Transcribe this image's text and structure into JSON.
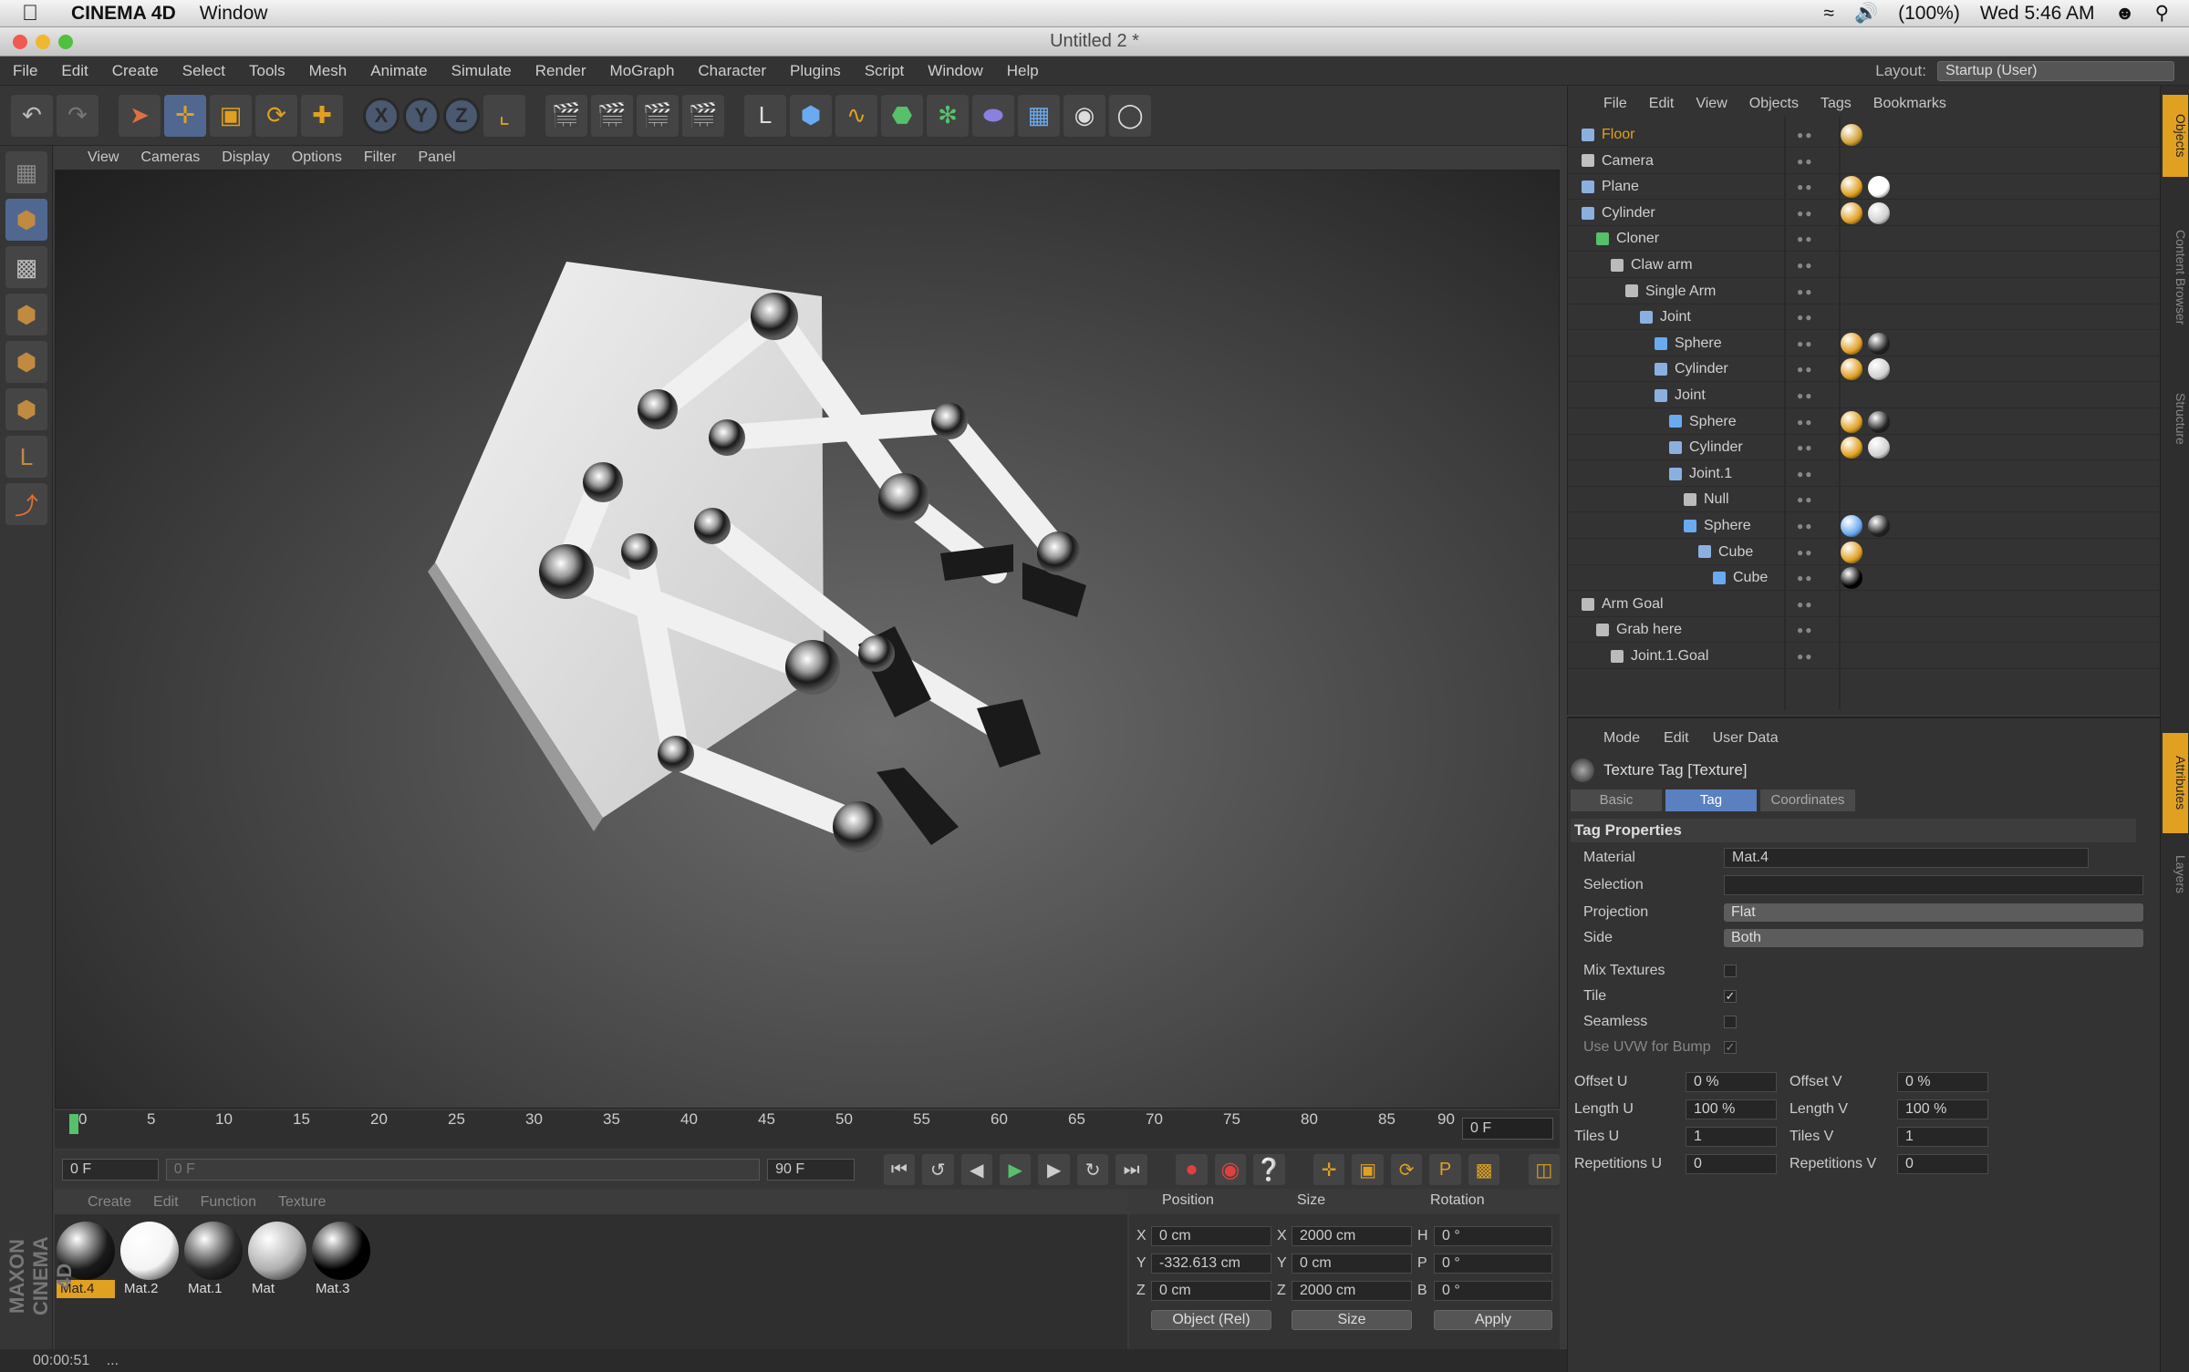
{
  "macbar": {
    "app": "CINEMA 4D",
    "menu": "Window",
    "battery": "(100%)",
    "clock": "Wed 5:46 AM"
  },
  "window": {
    "title": "Untitled 2 *"
  },
  "menubar": {
    "items": [
      "File",
      "Edit",
      "Create",
      "Select",
      "Tools",
      "Mesh",
      "Animate",
      "Simulate",
      "Render",
      "MoGraph",
      "Character",
      "Plugins",
      "Script",
      "Window",
      "Help"
    ],
    "layout_label": "Layout:",
    "layout_value": "Startup (User)"
  },
  "viewport": {
    "menu": [
      "View",
      "Cameras",
      "Display",
      "Options",
      "Filter",
      "Panel"
    ]
  },
  "timeline": {
    "ticks": [
      "0",
      "5",
      "10",
      "15",
      "20",
      "25",
      "30",
      "35",
      "40",
      "45",
      "50",
      "55",
      "60",
      "65",
      "70",
      "75",
      "80",
      "85",
      "90"
    ],
    "current_frame": "0 F"
  },
  "transport": {
    "start": "0 F",
    "range_start": "0 F",
    "range_end": "90 F",
    "end": "90 F"
  },
  "material_manager": {
    "menu": [
      "Create",
      "Edit",
      "Function",
      "Texture"
    ],
    "materials": [
      {
        "name": "Mat.4",
        "selected": true,
        "color": "#1a1a1a"
      },
      {
        "name": "Mat.2",
        "selected": false,
        "color": "#f4f4f4"
      },
      {
        "name": "Mat.1",
        "selected": false,
        "color": "#2a2a2a"
      },
      {
        "name": "Mat",
        "selected": false,
        "color": "#b0b0b0"
      },
      {
        "name": "Mat.3",
        "selected": false,
        "color": "#000000"
      }
    ]
  },
  "coordinates": {
    "headers": [
      "Position",
      "Size",
      "Rotation"
    ],
    "rows": [
      {
        "axis": "X",
        "pos": "0 cm",
        "size_axis": "X",
        "size": "2000 cm",
        "rot_axis": "H",
        "rot": "0 °"
      },
      {
        "axis": "Y",
        "pos": "-332.613 cm",
        "size_axis": "Y",
        "size": "0 cm",
        "rot_axis": "P",
        "rot": "0 °"
      },
      {
        "axis": "Z",
        "pos": "0 cm",
        "size_axis": "Z",
        "size": "2000 cm",
        "rot_axis": "B",
        "rot": "0 °"
      }
    ],
    "mode": "Object (Rel)",
    "size_mode": "Size",
    "apply": "Apply"
  },
  "status": {
    "time": "00:00:51",
    "extra": "..."
  },
  "brand": "MAXON CINEMA 4D",
  "object_manager": {
    "menu": [
      "File",
      "Edit",
      "View",
      "Objects",
      "Tags",
      "Bookmarks"
    ],
    "objects": [
      {
        "name": "Floor",
        "indent": 0,
        "color": "#e0a020",
        "icon": "#8ab0e0",
        "tags": [
          "#d0a030"
        ]
      },
      {
        "name": "Camera",
        "indent": 0,
        "color": "#d0d0d0",
        "icon": "#c0c0c0",
        "tags": []
      },
      {
        "name": "Plane",
        "indent": 0,
        "color": "#d0d0d0",
        "icon": "#8ab0e0",
        "tags": [
          "#e0a020",
          "#ffffff"
        ]
      },
      {
        "name": "Cylinder",
        "indent": 0,
        "color": "#d0d0d0",
        "icon": "#8ab0e0",
        "tags": [
          "#e0a020",
          "#d0d0d0"
        ]
      },
      {
        "name": "Cloner",
        "indent": 1,
        "color": "#d0d0d0",
        "icon": "#56c06a",
        "tags": []
      },
      {
        "name": "Claw arm",
        "indent": 2,
        "color": "#d0d0d0",
        "icon": "#bbbbbb",
        "tags": []
      },
      {
        "name": "Single Arm",
        "indent": 3,
        "color": "#d0d0d0",
        "icon": "#bbbbbb",
        "tags": []
      },
      {
        "name": "Joint",
        "indent": 4,
        "color": "#d0d0d0",
        "icon": "#8ab0e0",
        "tags": []
      },
      {
        "name": "Sphere",
        "indent": 5,
        "color": "#d0d0d0",
        "icon": "#6aaaf0",
        "tags": [
          "#e0a020",
          "#222222"
        ]
      },
      {
        "name": "Cylinder",
        "indent": 5,
        "color": "#d0d0d0",
        "icon": "#8ab0e0",
        "tags": [
          "#e0a020",
          "#d0d0d0"
        ]
      },
      {
        "name": "Joint",
        "indent": 5,
        "color": "#d0d0d0",
        "icon": "#8ab0e0",
        "tags": []
      },
      {
        "name": "Sphere",
        "indent": 6,
        "color": "#d0d0d0",
        "icon": "#6aaaf0",
        "tags": [
          "#e0a020",
          "#222222"
        ]
      },
      {
        "name": "Cylinder",
        "indent": 6,
        "color": "#d0d0d0",
        "icon": "#8ab0e0",
        "tags": [
          "#e0a020",
          "#d0d0d0"
        ]
      },
      {
        "name": "Joint.1",
        "indent": 6,
        "color": "#d0d0d0",
        "icon": "#8ab0e0",
        "tags": []
      },
      {
        "name": "Null",
        "indent": 7,
        "color": "#d0d0d0",
        "icon": "#bbbbbb",
        "tags": []
      },
      {
        "name": "Sphere",
        "indent": 7,
        "color": "#d0d0d0",
        "icon": "#6aaaf0",
        "tags": [
          "#6aaaf0",
          "#222222"
        ]
      },
      {
        "name": "Cube",
        "indent": 8,
        "color": "#d0d0d0",
        "icon": "#8ab0e0",
        "tags": [
          "#e0a020"
        ]
      },
      {
        "name": "Cube",
        "indent": 9,
        "color": "#d0d0d0",
        "icon": "#6aaaf0",
        "tags": [
          "#000000"
        ]
      },
      {
        "name": "Arm Goal",
        "indent": 0,
        "color": "#d0d0d0",
        "icon": "#bbbbbb",
        "tags": []
      },
      {
        "name": "Grab here",
        "indent": 1,
        "color": "#d0d0d0",
        "icon": "#bbbbbb",
        "tags": []
      },
      {
        "name": "Joint.1.Goal",
        "indent": 2,
        "color": "#d0d0d0",
        "icon": "#bbbbbb",
        "tags": []
      }
    ]
  },
  "attributes": {
    "menu": [
      "Mode",
      "Edit",
      "User Data"
    ],
    "title": "Texture Tag [Texture]",
    "tabs": [
      {
        "label": "Basic",
        "selected": false
      },
      {
        "label": "Tag",
        "selected": true
      },
      {
        "label": "Coordinates",
        "selected": false
      }
    ],
    "section": "Tag Properties",
    "material_label": "Material",
    "material_value": "Mat.4",
    "selection_label": "Selection",
    "selection_value": "",
    "projection_label": "Projection",
    "projection_value": "Flat",
    "side_label": "Side",
    "side_value": "Both",
    "mix_label": "Mix Textures",
    "mix_checked": false,
    "tile_label": "Tile",
    "tile_checked": true,
    "seamless_label": "Seamless",
    "seamless_checked": false,
    "uvw_label": "Use UVW for Bump",
    "uvw_checked": true,
    "offset_u_label": "Offset U",
    "offset_u": "0 %",
    "offset_v_label": "Offset V",
    "offset_v": "0 %",
    "length_u_label": "Length U",
    "length_u": "100 %",
    "length_v_label": "Length V",
    "length_v": "100 %",
    "tiles_u_label": "Tiles U",
    "tiles_u": "1",
    "tiles_v_label": "Tiles V",
    "tiles_v": "1",
    "rep_u_label": "Repetitions U",
    "rep_u": "0",
    "rep_v_label": "Repetitions V",
    "rep_v": "0"
  },
  "side_tabs": [
    "Objects",
    "Content Browser",
    "Structure",
    "Attributes",
    "Layers"
  ]
}
